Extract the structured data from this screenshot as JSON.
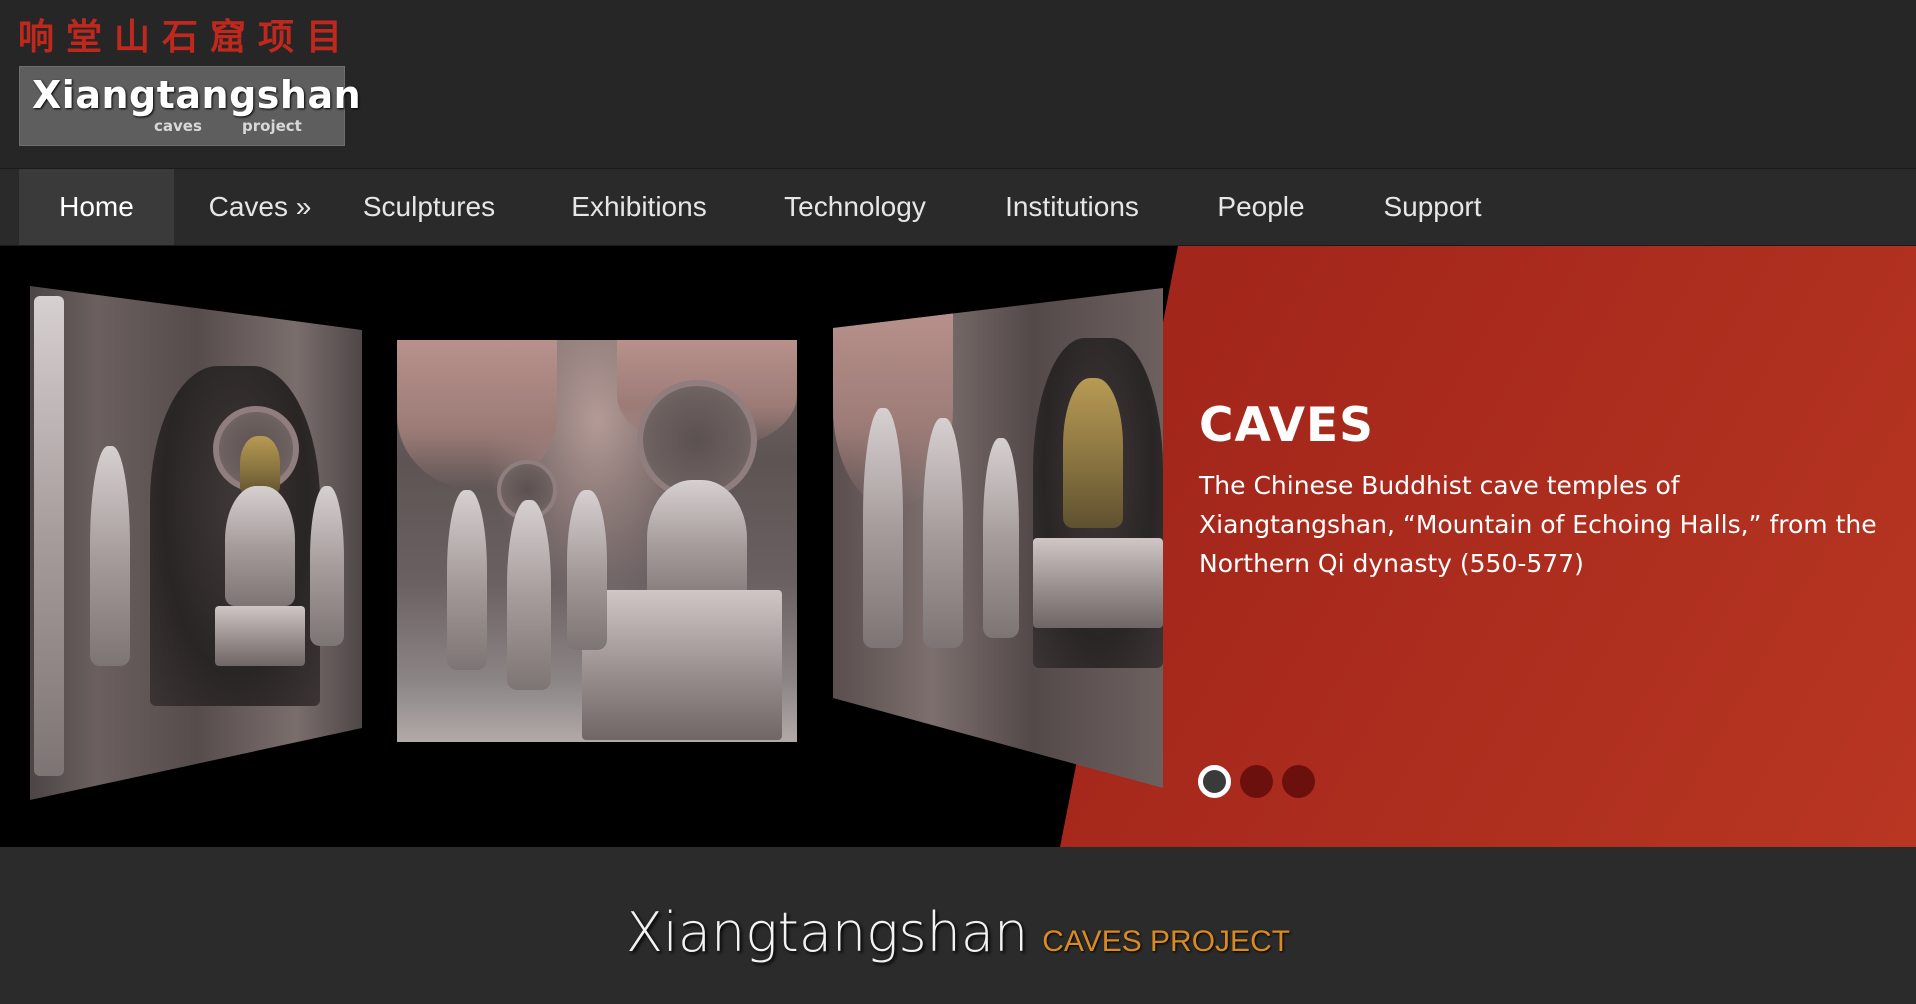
{
  "header": {
    "chinese_title": "响堂山石窟项目",
    "logo": {
      "main": "Xiangtangshan",
      "sub1": "caves",
      "sub2": "project"
    }
  },
  "nav": {
    "items": [
      {
        "label": "Home",
        "active": true
      },
      {
        "label": "Caves »"
      },
      {
        "label": "Sculptures"
      },
      {
        "label": "Exhibitions"
      },
      {
        "label": "Technology"
      },
      {
        "label": "Institutions"
      },
      {
        "label": "People"
      },
      {
        "label": "Support"
      }
    ]
  },
  "hero": {
    "title": "CAVES",
    "text": "The Chinese Buddhist cave temples of Xiangtangshan, “Mountain of Echoing Halls,” from the Northern Qi dynasty (550-577)",
    "slide_count": 3,
    "active_slide": 1
  },
  "site_title": {
    "main": "Xiangtangshan",
    "sub": "CAVES PROJECT"
  },
  "colors": {
    "brand_red": "#c0281e",
    "hero_red": "#a3261b",
    "accent_orange": "#d98a23",
    "background": "#2b2b2b"
  }
}
